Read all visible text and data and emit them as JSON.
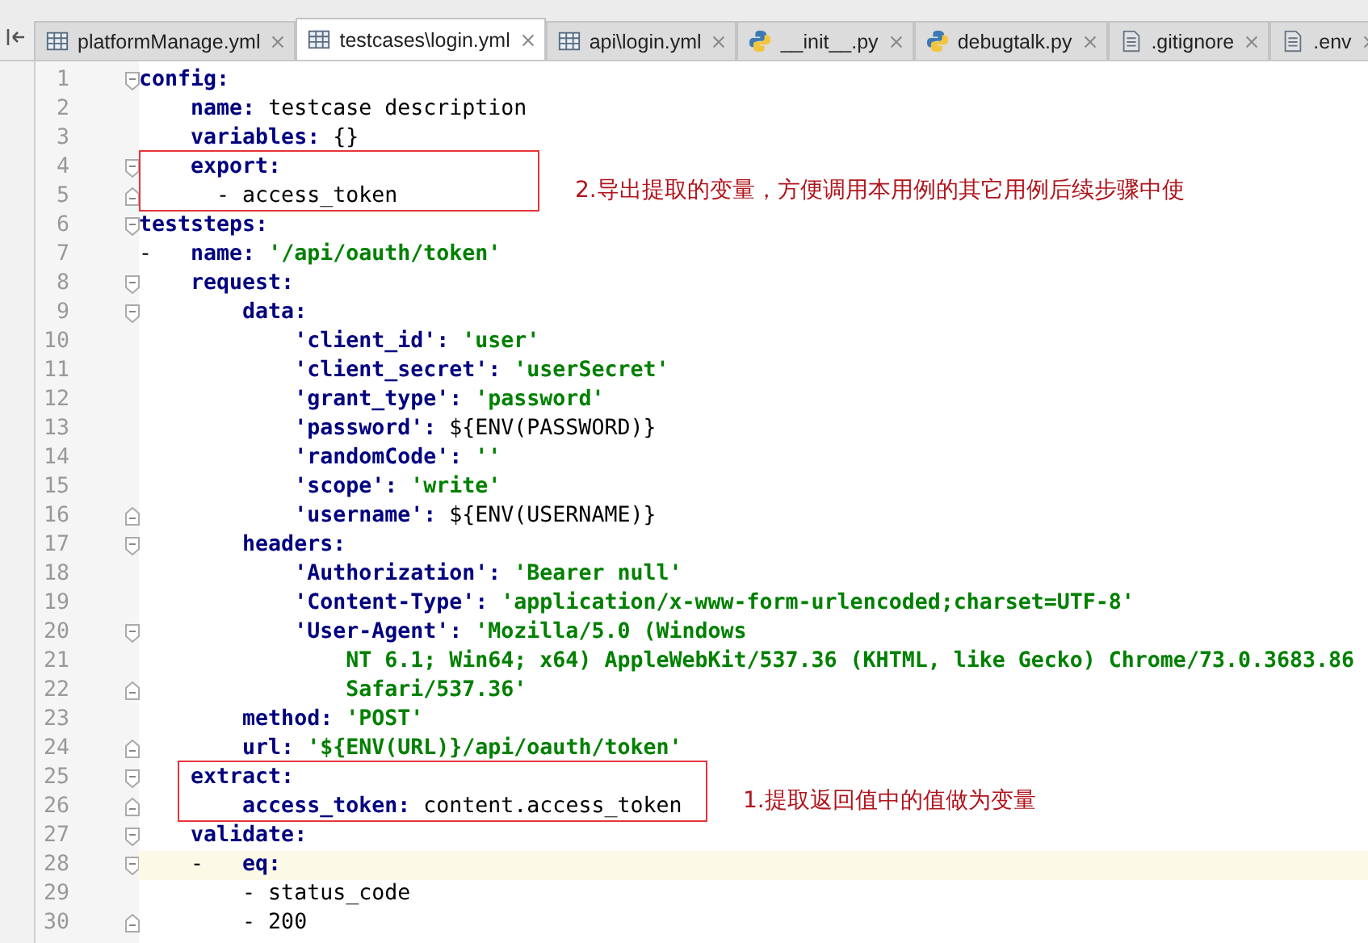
{
  "tabs": [
    {
      "label": "platformManage.yml",
      "kind": "yml",
      "selected": false
    },
    {
      "label": "testcases\\login.yml",
      "kind": "yml",
      "selected": true
    },
    {
      "label": "api\\login.yml",
      "kind": "yml",
      "selected": false
    },
    {
      "label": "__init__.py",
      "kind": "py",
      "selected": false
    },
    {
      "label": "debugtalk.py",
      "kind": "py",
      "selected": false
    },
    {
      "label": ".gitignore",
      "kind": "text",
      "selected": false
    },
    {
      "label": ".env",
      "kind": "text",
      "selected": false
    }
  ],
  "editor": {
    "lines": [
      {
        "number": "1",
        "kind": "fold_start",
        "current": false,
        "tokens": [
          {
            "kind": "key",
            "text": "config:"
          }
        ]
      },
      {
        "number": "2",
        "kind": "plain",
        "current": false,
        "tokens": [
          {
            "kind": "key",
            "text": "    name:"
          },
          {
            "kind": "text",
            "text": " testcase description"
          }
        ]
      },
      {
        "number": "3",
        "kind": "plain",
        "current": false,
        "tokens": [
          {
            "kind": "key",
            "text": "    variables:"
          },
          {
            "kind": "text",
            "text": " {}"
          }
        ]
      },
      {
        "number": "4",
        "kind": "fold_start",
        "current": false,
        "tokens": [
          {
            "kind": "key",
            "text": "    export:"
          }
        ]
      },
      {
        "number": "5",
        "kind": "fold_end",
        "current": false,
        "tokens": [
          {
            "kind": "text",
            "text": "      - access_token"
          }
        ]
      },
      {
        "number": "6",
        "kind": "fold_start",
        "current": false,
        "tokens": [
          {
            "kind": "key",
            "text": "teststeps:"
          }
        ]
      },
      {
        "number": "7",
        "kind": "plain",
        "current": false,
        "tokens": [
          {
            "kind": "text",
            "text": "-   "
          },
          {
            "kind": "key",
            "text": "name:"
          },
          {
            "kind": "str",
            "text": " '/api/oauth/token'"
          }
        ]
      },
      {
        "number": "8",
        "kind": "fold_start",
        "current": false,
        "tokens": [
          {
            "kind": "key",
            "text": "    request:"
          }
        ]
      },
      {
        "number": "9",
        "kind": "fold_start",
        "current": false,
        "tokens": [
          {
            "kind": "key",
            "text": "        data:"
          }
        ]
      },
      {
        "number": "10",
        "kind": "plain",
        "current": false,
        "tokens": [
          {
            "kind": "key",
            "text": "            'client_id':"
          },
          {
            "kind": "str",
            "text": " 'user'"
          }
        ]
      },
      {
        "number": "11",
        "kind": "plain",
        "current": false,
        "tokens": [
          {
            "kind": "key",
            "text": "            'client_secret':"
          },
          {
            "kind": "str",
            "text": " 'userSecret'"
          }
        ]
      },
      {
        "number": "12",
        "kind": "plain",
        "current": false,
        "tokens": [
          {
            "kind": "key",
            "text": "            'grant_type':"
          },
          {
            "kind": "str",
            "text": " 'password'"
          }
        ]
      },
      {
        "number": "13",
        "kind": "plain",
        "current": false,
        "tokens": [
          {
            "kind": "key",
            "text": "            'password':"
          },
          {
            "kind": "text",
            "text": " ${ENV(PASSWORD)}"
          }
        ]
      },
      {
        "number": "14",
        "kind": "plain",
        "current": false,
        "tokens": [
          {
            "kind": "key",
            "text": "            'randomCode':"
          },
          {
            "kind": "str",
            "text": " ''"
          }
        ]
      },
      {
        "number": "15",
        "kind": "plain",
        "current": false,
        "tokens": [
          {
            "kind": "key",
            "text": "            'scope':"
          },
          {
            "kind": "str",
            "text": " 'write'"
          }
        ]
      },
      {
        "number": "16",
        "kind": "fold_end",
        "current": false,
        "tokens": [
          {
            "kind": "key",
            "text": "            'username':"
          },
          {
            "kind": "text",
            "text": " ${ENV(USERNAME)}"
          }
        ]
      },
      {
        "number": "17",
        "kind": "fold_start",
        "current": false,
        "tokens": [
          {
            "kind": "key",
            "text": "        headers:"
          }
        ]
      },
      {
        "number": "18",
        "kind": "plain",
        "current": false,
        "tokens": [
          {
            "kind": "key",
            "text": "            'Authorization':"
          },
          {
            "kind": "str",
            "text": " 'Bearer null'"
          }
        ]
      },
      {
        "number": "19",
        "kind": "plain",
        "current": false,
        "tokens": [
          {
            "kind": "key",
            "text": "            'Content-Type':"
          },
          {
            "kind": "str",
            "text": " 'application/x-www-form-urlencoded;charset=UTF-8'"
          }
        ]
      },
      {
        "number": "20",
        "kind": "fold_start",
        "current": false,
        "tokens": [
          {
            "kind": "key",
            "text": "            'User-Agent':"
          },
          {
            "kind": "str",
            "text": " 'Mozilla/5.0 (Windows"
          }
        ]
      },
      {
        "number": "21",
        "kind": "plain",
        "current": false,
        "tokens": [
          {
            "kind": "str",
            "text": "                NT 6.1; Win64; x64) AppleWebKit/537.36 (KHTML, like Gecko) Chrome/73.0.3683.86"
          }
        ]
      },
      {
        "number": "22",
        "kind": "fold_end",
        "current": false,
        "tokens": [
          {
            "kind": "str",
            "text": "                Safari/537.36'"
          }
        ]
      },
      {
        "number": "23",
        "kind": "plain",
        "current": false,
        "tokens": [
          {
            "kind": "key",
            "text": "        method:"
          },
          {
            "kind": "str",
            "text": " 'POST'"
          }
        ]
      },
      {
        "number": "24",
        "kind": "fold_end",
        "current": false,
        "tokens": [
          {
            "kind": "key",
            "text": "        url:"
          },
          {
            "kind": "str",
            "text": " '${ENV(URL)}/api/oauth/token'"
          }
        ]
      },
      {
        "number": "25",
        "kind": "fold_start",
        "current": false,
        "tokens": [
          {
            "kind": "key",
            "text": "    extract:"
          }
        ]
      },
      {
        "number": "26",
        "kind": "fold_end",
        "current": false,
        "tokens": [
          {
            "kind": "key",
            "text": "        access_token:"
          },
          {
            "kind": "text",
            "text": " content.access_token"
          }
        ]
      },
      {
        "number": "27",
        "kind": "fold_start",
        "current": false,
        "tokens": [
          {
            "kind": "key",
            "text": "    validate:"
          }
        ]
      },
      {
        "number": "28",
        "kind": "fold_start",
        "current": true,
        "tokens": [
          {
            "kind": "text",
            "text": "    -   "
          },
          {
            "kind": "key",
            "text": "eq:"
          }
        ]
      },
      {
        "number": "29",
        "kind": "plain",
        "current": false,
        "tokens": [
          {
            "kind": "text",
            "text": "        - status_code"
          }
        ]
      },
      {
        "number": "30",
        "kind": "fold_end",
        "current": false,
        "tokens": [
          {
            "kind": "text",
            "text": "        - 200"
          }
        ]
      }
    ]
  },
  "annotations": [
    {
      "text": "2.导出提取的变量，方便调用本用例的其它用例后续步骤中使"
    },
    {
      "text": "1.提取返回值中的值做为变量"
    }
  ]
}
